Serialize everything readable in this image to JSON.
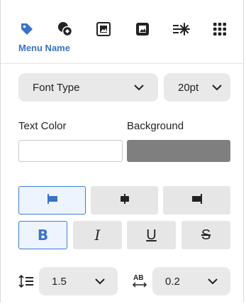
{
  "toolbar": {
    "icons": [
      "tag-icon",
      "shape-badge-icon",
      "image-frame-icon",
      "image-filled-icon",
      "sparkle-lines-icon",
      "grid-dots-icon"
    ],
    "active_label": "Menu Name",
    "accent": "#3a73c4"
  },
  "font": {
    "type_label": "Font Type",
    "size_value": "20pt"
  },
  "colors": {
    "text_label": "Text Color",
    "background_label": "Background",
    "text_color_value": "#ffffff",
    "background_value": "#7f7f7f"
  },
  "alignment": {
    "options": [
      "align-left-icon",
      "align-center-icon",
      "align-right-icon"
    ],
    "selected": "align-left-icon"
  },
  "style": {
    "bold": "B",
    "italic": "I",
    "underline": "U",
    "strike": "S",
    "bold_active": true
  },
  "spacing": {
    "line_value": "1.5",
    "letter_value": "0.2"
  }
}
